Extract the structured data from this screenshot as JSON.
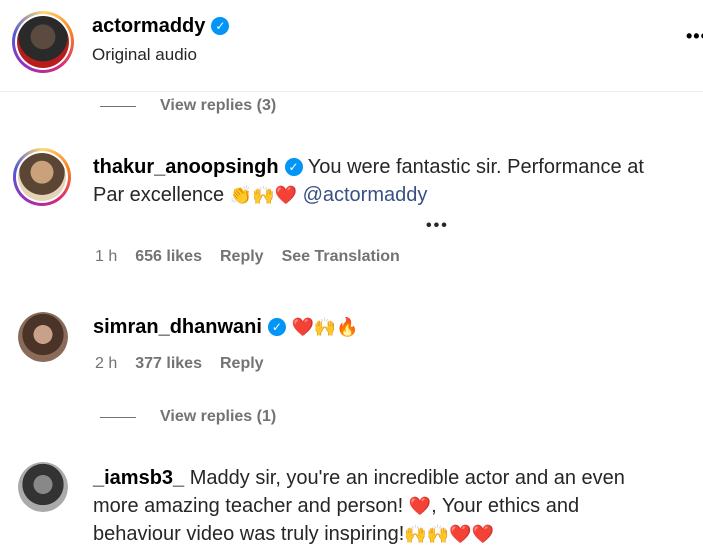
{
  "header": {
    "username": "actormaddy",
    "subtitle": "Original audio",
    "more": "•••"
  },
  "replies_1": {
    "label": "View replies (3)"
  },
  "comments": [
    {
      "username": "thakur_anoopsingh",
      "text_line1": "You were fantastic sir. Performance at",
      "text_line2": "Par excellence",
      "emojis": "👏🙌❤️",
      "mention": "@actormaddy",
      "more": "•••",
      "time": "1 h",
      "likes": "656 likes",
      "reply": "Reply",
      "translate": "See Translation"
    },
    {
      "username": "simran_dhanwani",
      "emojis": "❤️🙌🔥",
      "time": "2 h",
      "likes": "377 likes",
      "reply": "Reply"
    },
    {
      "username": "_iamsb3_",
      "text_line1": "Maddy sir, you're an incredible actor and an even",
      "text_line2": "more amazing teacher and person!",
      "emoji_a": "❤️",
      "text_line2b": ", Your ethics and",
      "text_line3": "behaviour video was truly inspiring!",
      "emojis_end": "🙌🙌❤️❤️"
    }
  ],
  "replies_2": {
    "label": "View replies (1)"
  },
  "colors": {
    "verified": "#0095f6",
    "mention": "#385185",
    "muted": "#737373"
  }
}
